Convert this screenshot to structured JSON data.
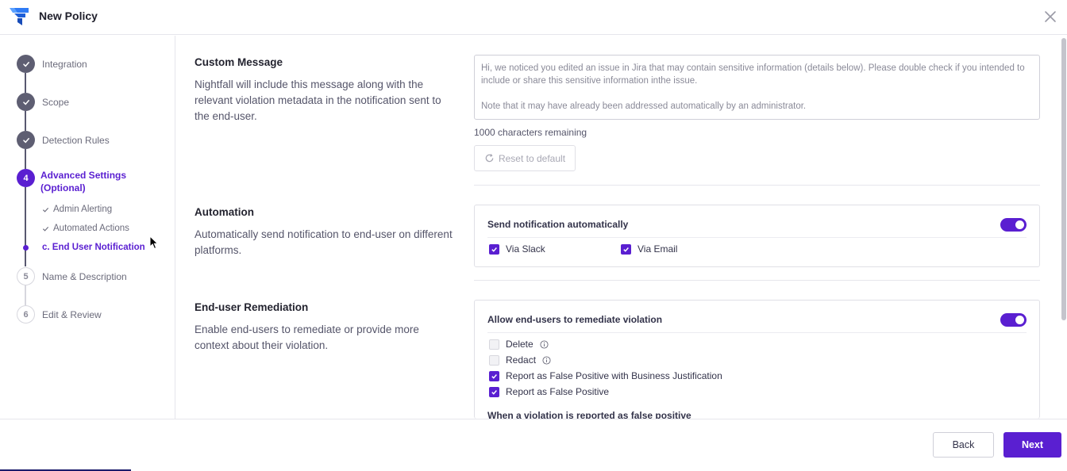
{
  "header": {
    "title": "New Policy"
  },
  "steps": [
    {
      "label": "Integration",
      "status": "done"
    },
    {
      "label": "Scope",
      "status": "done"
    },
    {
      "label": "Detection Rules",
      "status": "done"
    },
    {
      "label": "Advanced Settings (Optional)",
      "status": "active",
      "number": "4"
    },
    {
      "label": "Name & Description",
      "status": "todo",
      "number": "5"
    },
    {
      "label": "Edit & Review",
      "status": "todo",
      "number": "6"
    }
  ],
  "substeps": [
    {
      "label": "Admin Alerting"
    },
    {
      "label": "Automated Actions"
    },
    {
      "label": "c. End User Notification"
    }
  ],
  "custom_message": {
    "title": "Custom Message",
    "description": "Nightfall will include this message along with the relevant violation metadata in the notification sent to the end-user.",
    "text_line1": "Hi, we noticed you edited an issue in Jira that may contain sensitive information (details below). Please double check if you intended to include or share this sensitive information inthe issue.",
    "text_line2": "Note that it may have already been addressed automatically by an administrator.",
    "chars_remaining": "1000 characters remaining",
    "reset_label": "Reset to default"
  },
  "automation": {
    "title": "Automation",
    "description": "Automatically send notification to end-user on different platforms.",
    "card_title": "Send notification automatically",
    "options": [
      {
        "label": "Via Slack",
        "checked": true
      },
      {
        "label": "Via Email",
        "checked": true
      }
    ]
  },
  "remediation": {
    "title": "End-user Remediation",
    "description": "Enable end-users to remediate or provide more context about their violation.",
    "card_title": "Allow end-users to remediate violation",
    "options": [
      {
        "label": "Delete",
        "checked": false
      },
      {
        "label": "Redact",
        "checked": false
      },
      {
        "label": "Report as False Positive with Business Justification",
        "checked": true
      },
      {
        "label": "Report as False Positive",
        "checked": true
      }
    ],
    "followup": "When a violation is reported as false positive"
  },
  "footer": {
    "back_label": "Back",
    "next_label": "Next"
  },
  "colors": {
    "accent": "#5a1fd1",
    "done_step": "#5e5e72"
  }
}
